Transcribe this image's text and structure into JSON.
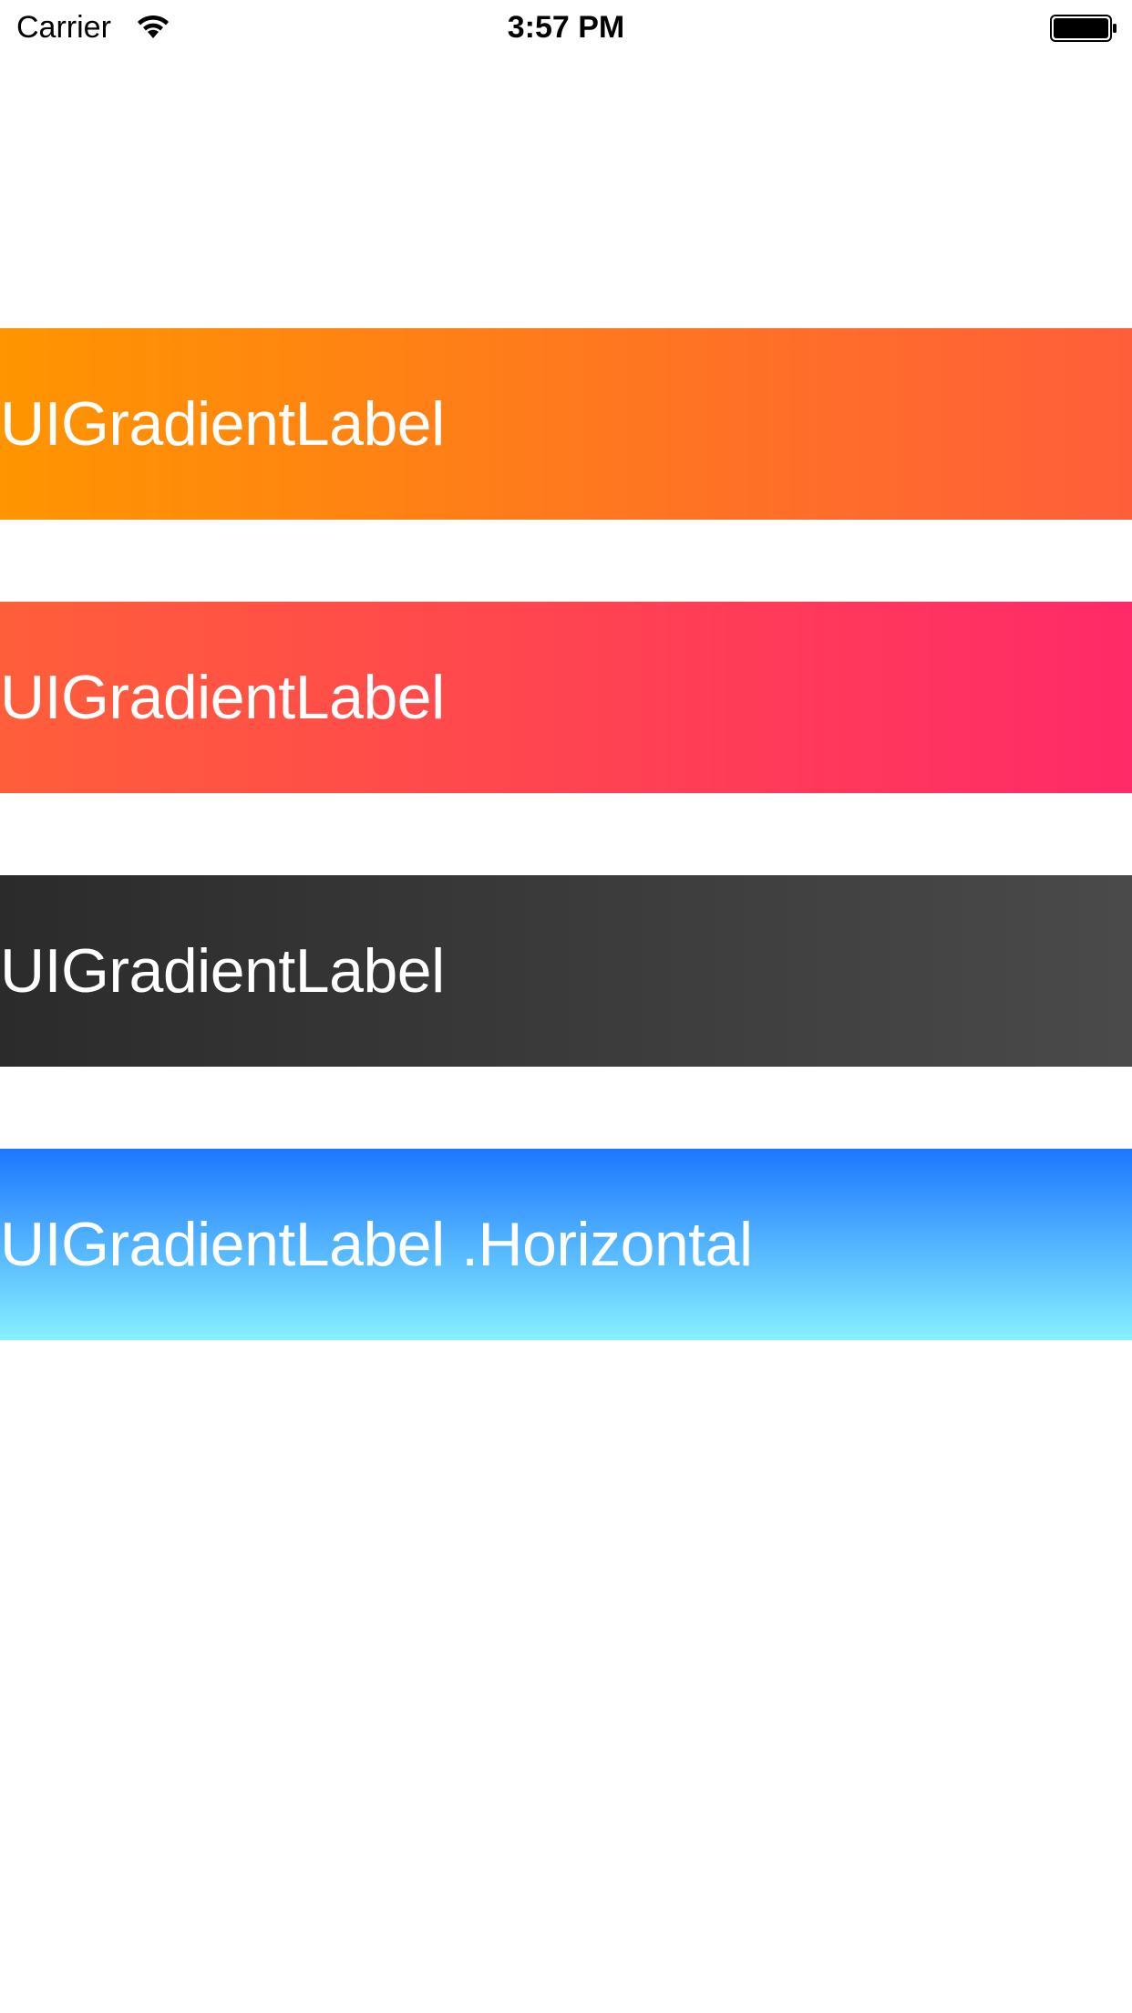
{
  "status_bar": {
    "carrier": "Carrier",
    "time": "3:57 PM",
    "icons": [
      "wifi-icon",
      "battery-icon"
    ]
  },
  "labels": [
    {
      "text": "UIGradientLabel",
      "gradient_direction": "left-to-right",
      "colors": [
        "#ff9500",
        "#ff5e3a"
      ]
    },
    {
      "text": "UIGradientLabel",
      "gradient_direction": "left-to-right",
      "colors": [
        "#ff5e3a",
        "#ff2a68"
      ]
    },
    {
      "text": "UIGradientLabel",
      "gradient_direction": "left-to-right",
      "colors": [
        "#2b2b2b",
        "#4a4a4a"
      ]
    },
    {
      "text": "UIGradientLabel .Horizontal",
      "gradient_direction": "top-to-bottom",
      "colors": [
        "#1d77ff",
        "#87f0ff"
      ]
    }
  ]
}
